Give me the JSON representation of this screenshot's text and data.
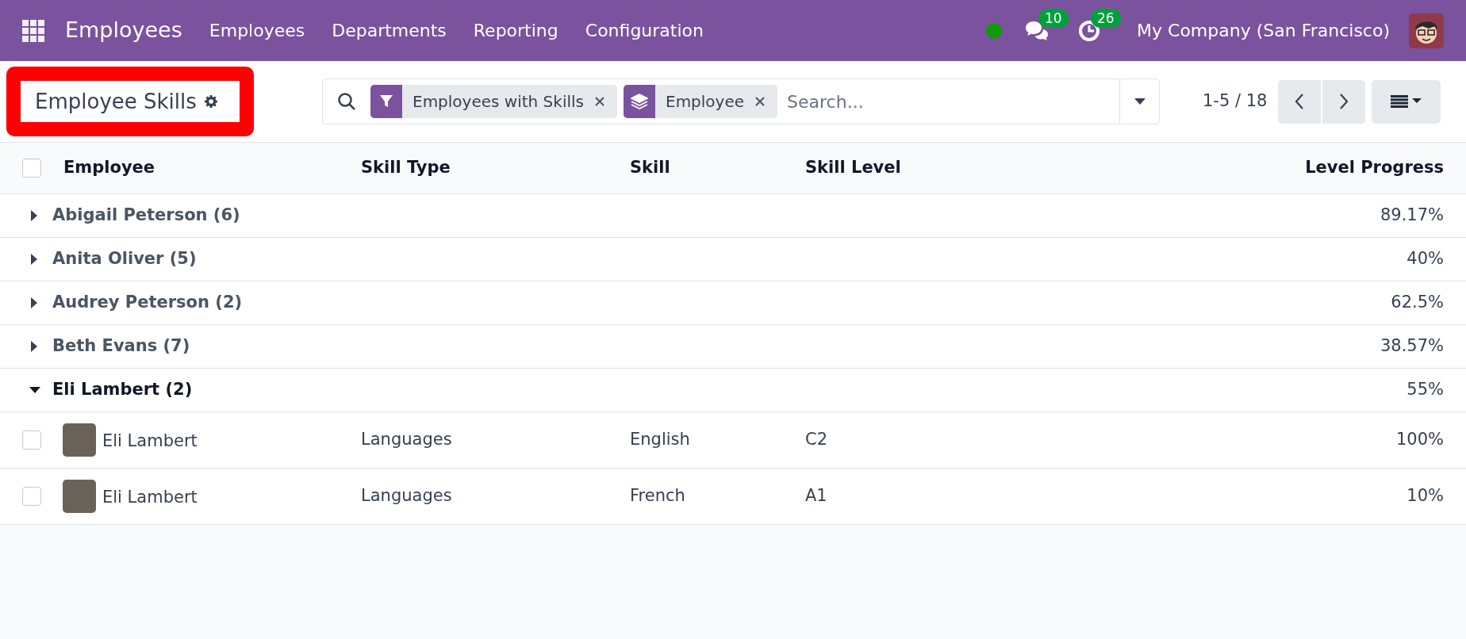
{
  "navbar": {
    "app_title": "Employees",
    "menu": [
      "Employees",
      "Departments",
      "Reporting",
      "Configuration"
    ],
    "messages_count": "10",
    "activities_count": "26",
    "company": "My Company (San Francisco)"
  },
  "control_panel": {
    "title": "Employee Skills",
    "highlighted": true,
    "facets": [
      {
        "kind": "filter",
        "label": "Employees with Skills"
      },
      {
        "kind": "group",
        "label": "Employee"
      }
    ],
    "search": {
      "placeholder": "Search..."
    },
    "pager": "1-5 / 18"
  },
  "table": {
    "columns": [
      "Employee",
      "Skill Type",
      "Skill",
      "Skill Level",
      "Level Progress"
    ],
    "header_checked": false,
    "groups": [
      {
        "label": "Abigail Peterson (6)",
        "expanded": false,
        "progress": "89.17%"
      },
      {
        "label": "Anita Oliver (5)",
        "expanded": false,
        "progress": "40%"
      },
      {
        "label": "Audrey Peterson (2)",
        "expanded": false,
        "progress": "62.5%"
      },
      {
        "label": "Beth Evans (7)",
        "expanded": false,
        "progress": "38.57%"
      },
      {
        "label": "Eli Lambert (2)",
        "expanded": true,
        "progress": "55%",
        "records": [
          {
            "employee": "Eli Lambert",
            "skill_type": "Languages",
            "skill": "English",
            "skill_level": "C2",
            "progress": "100%",
            "checked": false
          },
          {
            "employee": "Eli Lambert",
            "skill_type": "Languages",
            "skill": "French",
            "skill_level": "A1",
            "progress": "10%",
            "checked": false
          }
        ]
      }
    ]
  }
}
